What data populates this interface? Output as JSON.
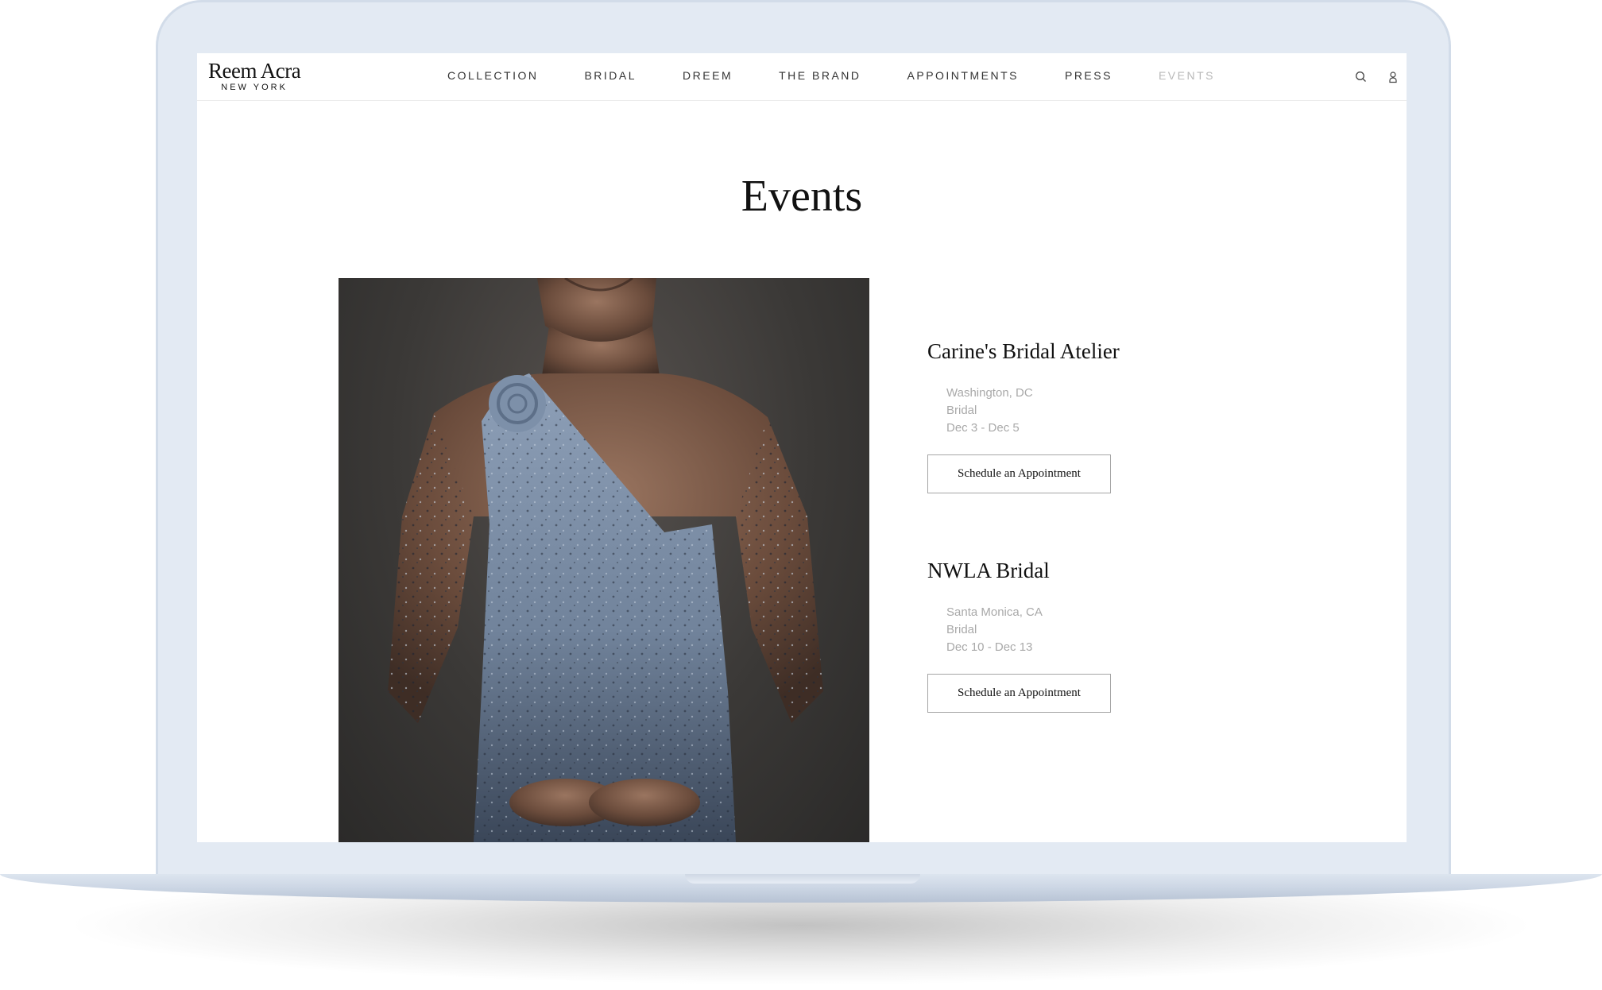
{
  "brand": {
    "name": "Reem Acra",
    "location": "NEW YORK"
  },
  "nav": {
    "items": [
      {
        "label": "COLLECTION"
      },
      {
        "label": "BRIDAL"
      },
      {
        "label": "DREEM"
      },
      {
        "label": "THE BRAND"
      },
      {
        "label": "APPOINTMENTS"
      },
      {
        "label": "PRESS"
      },
      {
        "label": "EVENTS",
        "active": true
      }
    ],
    "icons": [
      "search-icon",
      "user-icon"
    ]
  },
  "page": {
    "title": "Events"
  },
  "events": [
    {
      "name": "Carine's Bridal Atelier",
      "location": "Washington, DC",
      "category": "Bridal",
      "dates": "Dec 3 - Dec 5",
      "button": "Schedule an Appointment"
    },
    {
      "name": "NWLA Bridal",
      "location": "Santa Monica, CA",
      "category": "Bridal",
      "dates": "Dec 10 - Dec 13",
      "button": "Schedule an Appointment"
    }
  ],
  "colors": {
    "device_frame": "#e3eaf3",
    "nav_active": "#b8b8b8",
    "meta_text": "#a9a9a9",
    "dress_blue": "#7f92aa"
  }
}
